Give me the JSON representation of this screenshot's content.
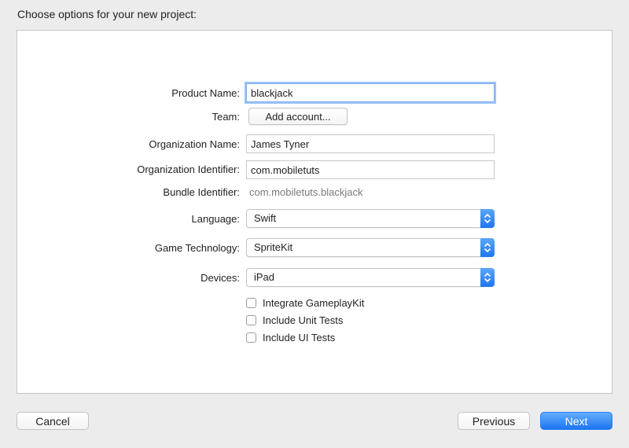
{
  "dialog": {
    "heading": "Choose options for your new project:"
  },
  "form": {
    "product_name": {
      "label": "Product Name:",
      "value": "blackjack"
    },
    "team": {
      "label": "Team:",
      "button_label": "Add account..."
    },
    "organization_name": {
      "label": "Organization Name:",
      "value": "James Tyner"
    },
    "organization_identifier": {
      "label": "Organization Identifier:",
      "value": "com.mobiletuts"
    },
    "bundle_identifier": {
      "label": "Bundle Identifier:",
      "value": "com.mobiletuts.blackjack"
    },
    "language": {
      "label": "Language:",
      "selected": "Swift"
    },
    "game_technology": {
      "label": "Game Technology:",
      "selected": "SpriteKit"
    },
    "devices": {
      "label": "Devices:",
      "selected": "iPad"
    },
    "checkboxes": [
      {
        "label": "Integrate GameplayKit",
        "checked": false
      },
      {
        "label": "Include Unit Tests",
        "checked": false
      },
      {
        "label": "Include UI Tests",
        "checked": false
      }
    ]
  },
  "footer": {
    "cancel_label": "Cancel",
    "previous_label": "Previous",
    "next_label": "Next"
  },
  "colors": {
    "accent": "#1d74f2",
    "focus_ring": "#9cc3f4",
    "window_bg": "#ececec",
    "panel_bg": "#ffffff"
  }
}
